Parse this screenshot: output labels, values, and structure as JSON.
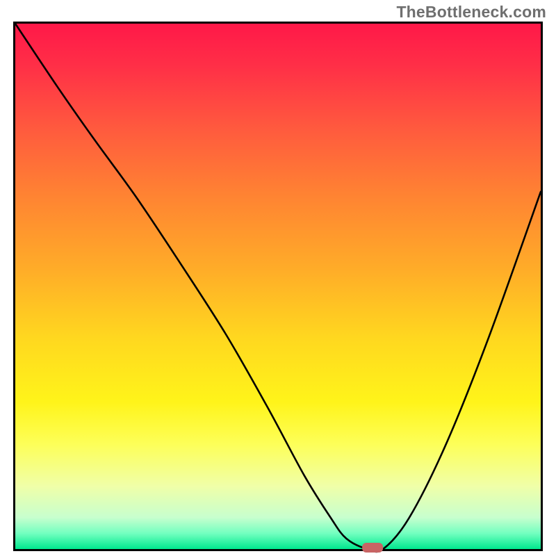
{
  "watermark": "TheBottleneck.com",
  "chart_data": {
    "type": "line",
    "title": "",
    "xlabel": "",
    "ylabel": "",
    "xlim": [
      0,
      100
    ],
    "ylim": [
      0,
      100
    ],
    "x": [
      0,
      8,
      15,
      23,
      31,
      40,
      48,
      55,
      60,
      63,
      67,
      70,
      75,
      82,
      90,
      100
    ],
    "values": [
      100,
      88,
      78,
      67,
      55,
      41,
      27,
      14,
      6,
      2,
      0,
      0,
      6,
      20,
      40,
      68
    ],
    "marker": {
      "x": 68,
      "y": 0
    },
    "gradient": {
      "top_color": "#ff1848",
      "mid_colors": [
        "#ff8432",
        "#ffd81f",
        "#fdff58"
      ],
      "bottom_color": "#00e88e"
    }
  }
}
